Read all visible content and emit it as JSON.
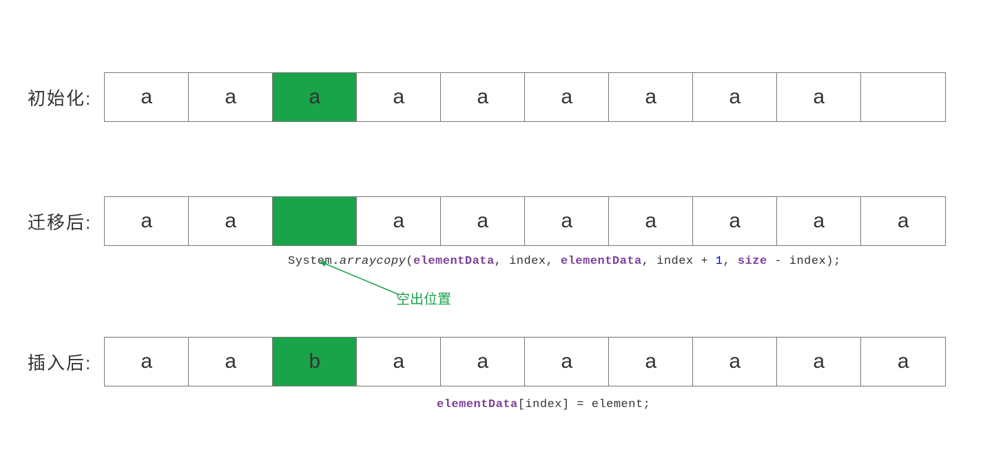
{
  "labels": {
    "row1": "初始化:",
    "row2": "迁移后:",
    "row3": "插入后:"
  },
  "arrays": {
    "init": [
      "a",
      "a",
      "a",
      "a",
      "a",
      "a",
      "a",
      "a",
      "a",
      ""
    ],
    "shift": [
      "a",
      "a",
      "",
      "a",
      "a",
      "a",
      "a",
      "a",
      "a",
      "a"
    ],
    "after": [
      "a",
      "a",
      "b",
      "a",
      "a",
      "a",
      "a",
      "a",
      "a",
      "a"
    ]
  },
  "highlightIndex": 2,
  "annotation": "空出位置",
  "code1": {
    "prefix": "System.",
    "method": "arraycopy",
    "open": "(",
    "p1": "elementData",
    "c1": ", index, ",
    "p2": "elementData",
    "c2": ", index + ",
    "one": "1",
    "c3": ", ",
    "p3": "size",
    "c4": " - index);"
  },
  "code2": {
    "p1": "elementData",
    "bracket_open": "[",
    "idx": "index",
    "bracket_close": "] = element;"
  },
  "colors": {
    "highlight": "#1aa44a",
    "text": "#333333",
    "purple": "#7f3f98",
    "blue": "#0000cc"
  }
}
